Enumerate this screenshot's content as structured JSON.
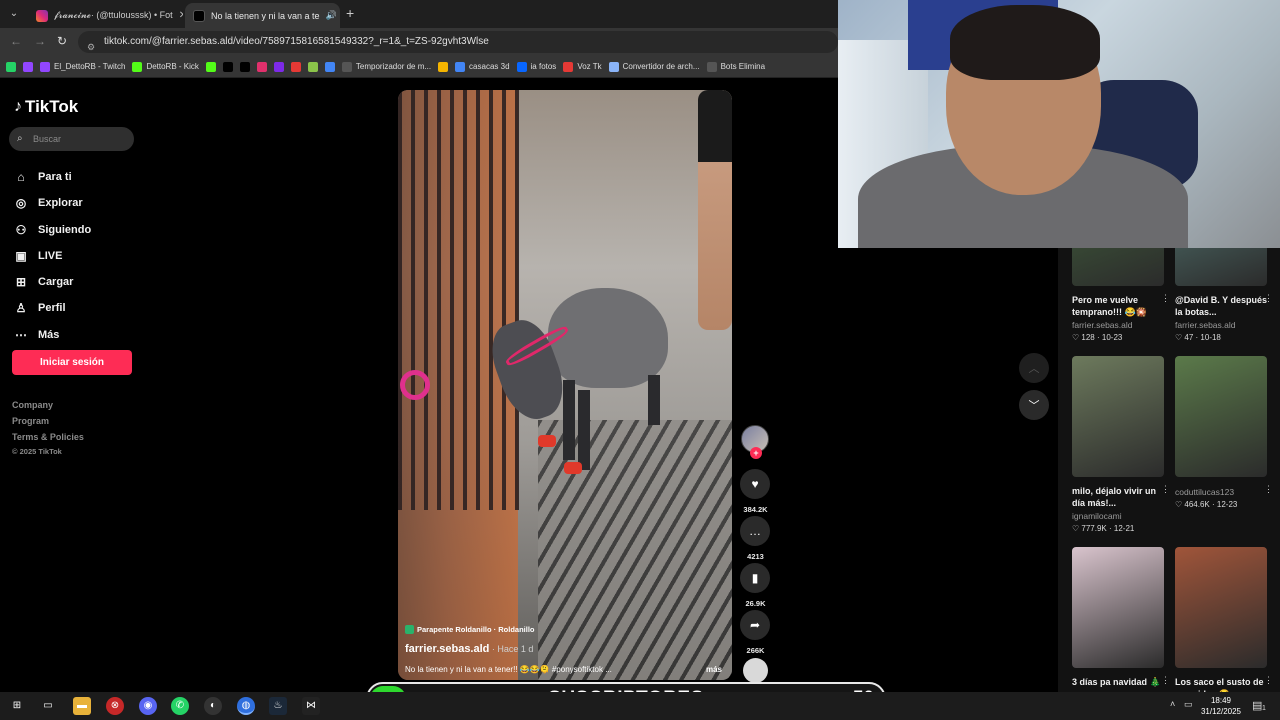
{
  "browser": {
    "tabs": [
      {
        "title": "𝓯𝓻𝓪𝓷𝓬𝓲𝓷𝓮· (@ttulousssk) • Fot",
        "active": false
      },
      {
        "title": "No la tienen y ni la van a te",
        "active": true
      }
    ],
    "url": "tiktok.com/@farrier.sebas.ald/video/7589715816581549332?_r=1&_t=ZS-92gvht3Wlse",
    "bookmarks": [
      {
        "label": "",
        "icon": "whatsapp-icon",
        "color": "#25d366"
      },
      {
        "label": "",
        "icon": "twitch-icon",
        "color": "#9146ff"
      },
      {
        "label": "El_DettoRB - Twitch",
        "icon": "twitch-icon",
        "color": "#9146ff"
      },
      {
        "label": "DettoRB - Kick",
        "icon": "kick-icon",
        "color": "#53fc18"
      },
      {
        "label": "",
        "icon": "kick-icon",
        "color": "#53fc18"
      },
      {
        "label": "",
        "icon": "tiktok-icon",
        "color": "#000000"
      },
      {
        "label": "",
        "icon": "x-icon",
        "color": "#000000"
      },
      {
        "label": "",
        "icon": "instagram-icon",
        "color": "#e1306c"
      },
      {
        "label": "",
        "icon": "canva-icon",
        "color": "#7d2ae8"
      },
      {
        "label": "",
        "icon": "app-icon",
        "color": "#e53935"
      },
      {
        "label": "",
        "icon": "app-icon",
        "color": "#8bc34a"
      },
      {
        "label": "",
        "icon": "app-icon",
        "color": "#4285f4"
      },
      {
        "label": "Temporizador de m...",
        "icon": "timer-icon",
        "color": "#555555"
      },
      {
        "label": "",
        "icon": "app-icon",
        "color": "#f4b400"
      },
      {
        "label": "casacas 3d",
        "icon": "image-icon",
        "color": "#4285f4"
      },
      {
        "label": "ia fotos",
        "icon": "meta-icon",
        "color": "#0866ff"
      },
      {
        "label": "Voz Tk",
        "icon": "app-icon",
        "color": "#e53935"
      },
      {
        "label": "Convertidor de arch...",
        "icon": "convert-icon",
        "color": "#8ab4f8"
      },
      {
        "label": "Bots Elimina",
        "icon": "bot-icon",
        "color": "#555555"
      }
    ]
  },
  "tiktok": {
    "logo": "TikTok",
    "search_placeholder": "Buscar",
    "nav": [
      {
        "label": "Para ti",
        "icon": "home-icon",
        "glyph": "⌂"
      },
      {
        "label": "Explorar",
        "icon": "compass-icon",
        "glyph": "◎"
      },
      {
        "label": "Siguiendo",
        "icon": "following-icon",
        "glyph": "⚇"
      },
      {
        "label": "LIVE",
        "icon": "live-icon",
        "glyph": "▣"
      },
      {
        "label": "Cargar",
        "icon": "upload-icon",
        "glyph": "⊞"
      },
      {
        "label": "Perfil",
        "icon": "profile-icon",
        "glyph": "♙"
      },
      {
        "label": "Más",
        "icon": "more-icon",
        "glyph": "⋯"
      }
    ],
    "login_button": "Iniciar sesión",
    "footer_links": [
      "Company",
      "Program",
      "Terms & Policies"
    ],
    "copyright": "© 2025 TikTok"
  },
  "video": {
    "location": "Parapente Roldanillo · Roldanillo",
    "author": "farrier.sebas.ald",
    "posted": " · Hace 1 d",
    "caption": "No la tienen y ni la van a tener!! 😂😂🫠 #ponysoftiktok ...",
    "more": "más",
    "likes": "384.2K",
    "comments": "4213",
    "saves": "26.9K",
    "shares": "266K"
  },
  "recommendations": [
    {
      "title": "Pero me vuelve temprano!!! 😂🎇",
      "author": "farrier.sebas.ald",
      "likes": "128",
      "date": "10-23",
      "thumb": "#3f5a3a"
    },
    {
      "title": "@David B. Y después la botas...",
      "author": "farrier.sebas.ald",
      "likes": "47",
      "date": "10-18",
      "thumb": "#4f6e6a"
    },
    {
      "title": "milo, déjalo vivir un día más!...",
      "author": "ignamilocami",
      "likes": "777.9K",
      "date": "12-21",
      "thumb": "#6d7a5d"
    },
    {
      "title": "",
      "author": "coduttilucas123",
      "likes": "464.6K",
      "date": "12-23",
      "thumb": "#5b7a4a"
    },
    {
      "title": "3 días pa navidad 🎄",
      "author": "",
      "likes": "",
      "date": "",
      "thumb": "#d9c4cd"
    },
    {
      "title": "Los saco el susto de sus vidas 😂",
      "author": "",
      "likes": "",
      "date": "",
      "thumb": "#a0553a"
    }
  ],
  "overlay": {
    "current": "0",
    "label": "SUSCRIPTORES",
    "goal": "50",
    "fill_fraction": 0.0
  },
  "taskbar": {
    "time": "18:49",
    "date": "31/12/2025",
    "notifications": "1"
  }
}
